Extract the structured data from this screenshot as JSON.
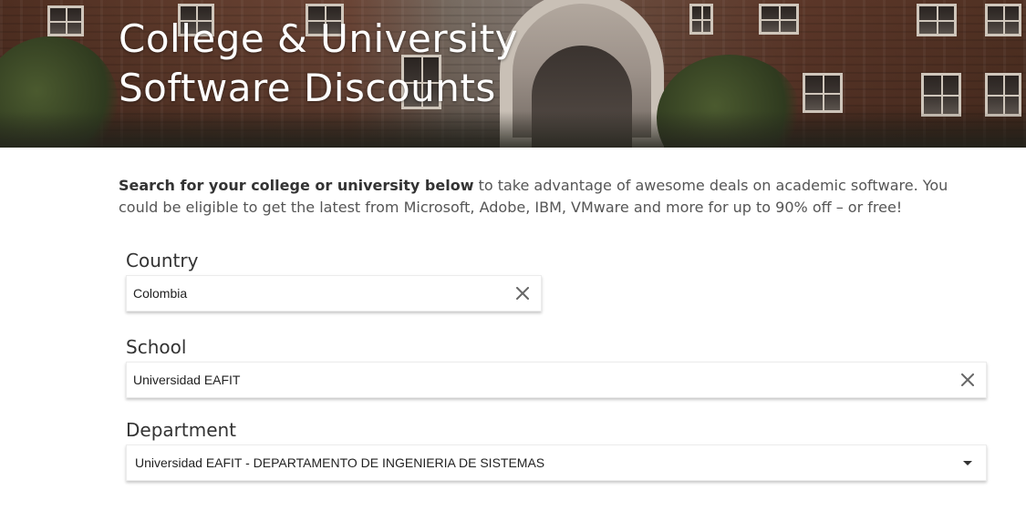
{
  "hero": {
    "title_line1": "College & University",
    "title_line2": "Software Discounts"
  },
  "intro": {
    "bold": "Search for your college or university below",
    "rest": " to take advantage of awesome deals on academic software. You could be eligible to get the latest from Microsoft, Adobe, IBM, VMware and more for up to 90% off – or free!"
  },
  "country": {
    "label": "Country",
    "value": "Colombia",
    "clear_icon": "close-icon"
  },
  "school": {
    "label": "School",
    "value": "Universidad EAFIT",
    "clear_icon": "close-icon"
  },
  "department": {
    "label": "Department",
    "value": "Universidad EAFIT - DEPARTAMENTO DE INGENIERIA DE SISTEMAS",
    "dropdown_icon": "caret-down-icon"
  },
  "colors": {
    "text_dark": "#333333",
    "text_body": "#555555",
    "icon": "#666666",
    "title": "#ffffff"
  }
}
